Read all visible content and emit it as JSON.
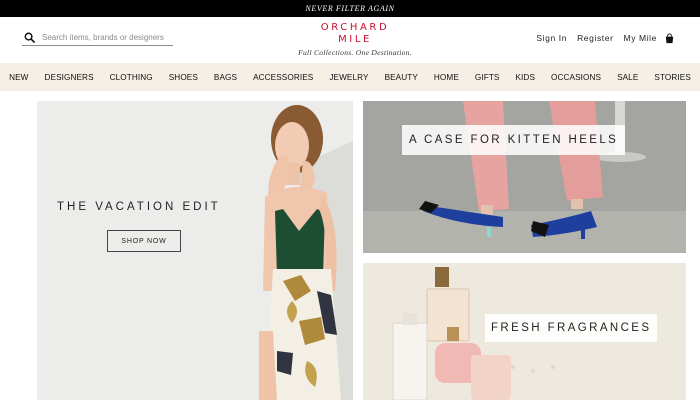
{
  "promo": {
    "text": "NEVER FILTER AGAIN"
  },
  "search": {
    "placeholder": "Search items, brands or designers"
  },
  "logo": {
    "line1": "ORCHARD",
    "line2": "MILE",
    "tagline": "Full Collections. One Destination."
  },
  "account": {
    "sign_in": "Sign In",
    "register": "Register",
    "my_mile": "My Mile"
  },
  "nav": {
    "items": [
      "NEW",
      "DESIGNERS",
      "CLOTHING",
      "SHOES",
      "BAGS",
      "ACCESSORIES",
      "JEWELRY",
      "BEAUTY",
      "HOME",
      "GIFTS",
      "KIDS",
      "OCCASIONS",
      "SALE",
      "STORIES"
    ]
  },
  "tiles": {
    "vacation": {
      "title": "THE VACATION EDIT",
      "cta": "SHOP NOW"
    },
    "heels": {
      "title": "A CASE FOR KITTEN HEELS"
    },
    "fragrances": {
      "title": "FRESH FRAGRANCES"
    }
  },
  "colors": {
    "brand_red": "#c8102e",
    "nav_bg": "#f6efe6",
    "promo_bg": "#000000"
  },
  "icons": {
    "search": "search-icon",
    "bag": "shopping-bag-icon"
  }
}
